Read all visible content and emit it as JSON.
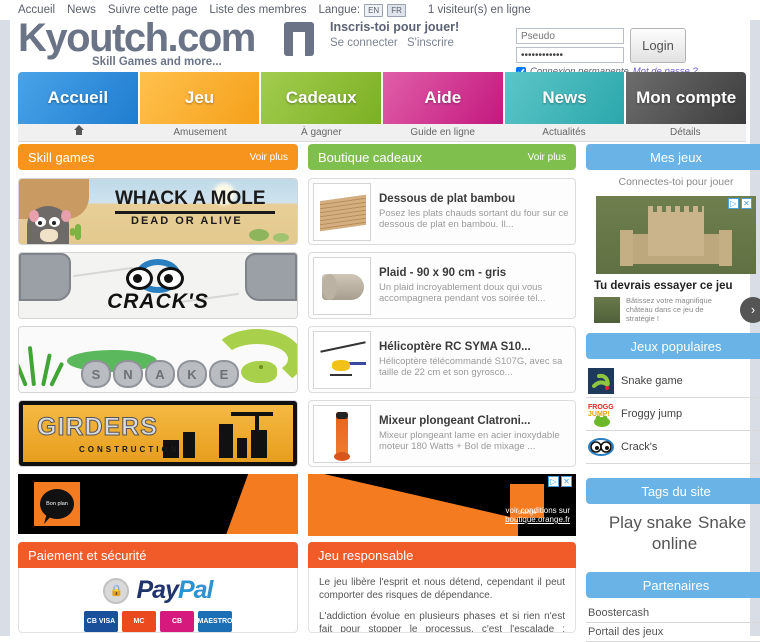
{
  "topbar": {
    "links": [
      "Accueil",
      "News",
      "Suivre cette page",
      "Liste des membres"
    ],
    "lang_label": "Langue:",
    "lang_en": "EN",
    "lang_fr": "FR",
    "visitors": "1 visiteur(s) en ligne"
  },
  "brand": {
    "name": "Kyoutch.com",
    "tagline": "Skill Games and more...",
    "signup_title": "Inscris-toi pour jouer!",
    "signup_link1": "Se connecter",
    "signup_link2": "S'inscrire"
  },
  "login": {
    "user_placeholder": "Pseudo",
    "user_value": "",
    "password_value": "............",
    "button": "Login",
    "remember_label": "Connexion permanente",
    "forgot_label": "Mot de passe ?",
    "remember_checked": true
  },
  "nav": {
    "items": [
      {
        "label": "Accueil",
        "sub": "",
        "icon": "home-icon",
        "color1": "#4aa3e8",
        "color2": "#1f7dd0"
      },
      {
        "label": "Jeu",
        "sub": "Amusement",
        "icon": "",
        "color1": "#ffc14d",
        "color2": "#f5a01a"
      },
      {
        "label": "Cadeaux",
        "sub": "À gagner",
        "icon": "",
        "color1": "#a2cc4e",
        "color2": "#7cb024"
      },
      {
        "label": "Aide",
        "sub": "Guide en ligne",
        "icon": "",
        "color1": "#e05fa8",
        "color2": "#c3187f"
      },
      {
        "label": "News",
        "sub": "Actualités",
        "icon": "",
        "color1": "#5cc6c9",
        "color2": "#2ba7ab"
      },
      {
        "label": "Mon compte",
        "sub": "Détails",
        "icon": "",
        "color1": "#6d6d6d",
        "color2": "#3d3d3d"
      }
    ]
  },
  "skill_games": {
    "title": "Skill games",
    "more": "Voir plus",
    "header_color": "#f7941d",
    "games": [
      {
        "name": "Whack a Mole",
        "line1": "WHACK A MOLE",
        "line2": "DEAD OR ALIVE"
      },
      {
        "name": "Crack's",
        "line1": "CRACK'S",
        "line2": ""
      },
      {
        "name": "Snake",
        "line1": "SNAKE",
        "line2": ""
      },
      {
        "name": "Girders",
        "line1": "GIRDERS",
        "line2": "CONSTRUCTION"
      }
    ]
  },
  "shop": {
    "title": "Boutique cadeaux",
    "more": "Voir plus",
    "header_color": "#7fbf4d",
    "products": [
      {
        "title": "Dessous de plat bambou",
        "desc": "Posez les plats chauds sortant du four sur ce dessous de plat en bambou. Il..."
      },
      {
        "title": "Plaid - 90 x 90 cm - gris",
        "desc": "Un plaid incroyablement doux qui vous accompagnera pendant vos soirée tél..."
      },
      {
        "title": "Hélicoptère RC SYMA S10...",
        "desc": "Hélicoptère télécommandé S107G, avec sa taille de 22 cm et son gyrosco..."
      },
      {
        "title": "Mixeur plongeant Clatroni...",
        "desc": "Mixeur plongeant lame en acier inoxydable moteur 180 Watts + Bol de mixage ..."
      }
    ]
  },
  "ad_orange": {
    "brand": "orange",
    "cond_line": "voir conditions sur",
    "cond_link": "boutique.orange.fr"
  },
  "ad_bon": {
    "label": "Bon plan"
  },
  "payment": {
    "title": "Paiement et sécurité",
    "header_color": "#f15a29",
    "brand_a": "Pay",
    "brand_b": "Pal",
    "cards": [
      {
        "label": "CB VISA",
        "color": "#1a4f9c"
      },
      {
        "label": "MC",
        "color": "#eb4a1f"
      },
      {
        "label": "CB",
        "color": "#d6197d"
      },
      {
        "label": "MAESTRO",
        "color": "#1a6fb5"
      }
    ]
  },
  "responsible": {
    "title": "Jeu responsable",
    "header_color": "#f15a29",
    "p1": "Le jeu libère l'esprit et nous détend, cependant il peut comporter des risques de dépendance.",
    "p2": "L'addiction évolue en plusieurs phases et si rien n'est fait pour stopper le processus, c'est l'escalade : endettement, solitude,"
  },
  "sidebar": {
    "my_games_title": "Mes jeux",
    "my_games_note": "Connectes-toi pour jouer",
    "ad": {
      "title": "Tu devrais essayer ce jeu",
      "copy": "Bâtissez votre magnifique château dans ce jeu de stratégie !",
      "arrow": "›"
    },
    "popular_title": "Jeux populaires",
    "popular": [
      {
        "label": "Snake game",
        "icon": "snake-thumb-icon"
      },
      {
        "label": "Froggy jump",
        "icon": "froggy-thumb-icon"
      },
      {
        "label": "Crack's",
        "icon": "cracks-thumb-icon"
      }
    ],
    "tags_title": "Tags du site",
    "tags": [
      "Play snake",
      "Snake online"
    ],
    "partners_title": "Partenaires",
    "partners": [
      "Boostercash",
      "Portail des jeux"
    ]
  }
}
